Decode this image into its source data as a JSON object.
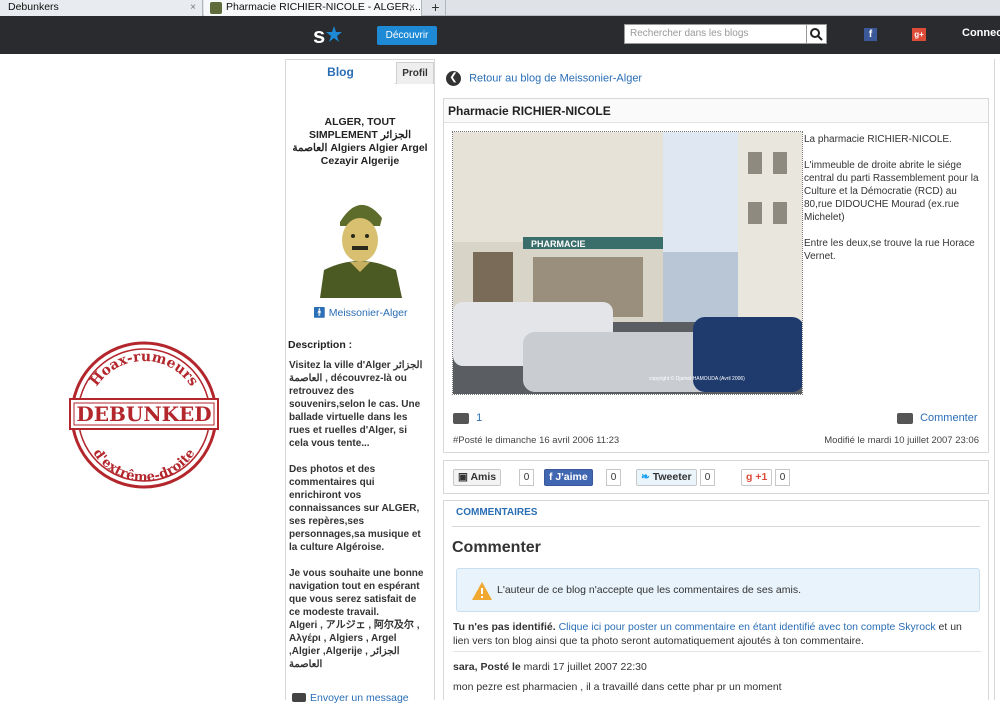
{
  "browser": {
    "tabs": [
      {
        "label": "Debunkers"
      },
      {
        "label": "Pharmacie RICHIER-NICOLE - ALGER,..."
      }
    ],
    "new_tab": "+",
    "close": "×"
  },
  "topbar": {
    "discover_label": "Découvrir",
    "search_placeholder": "Rechercher dans les blogs",
    "facebook": "f",
    "gplus": "g+",
    "connect_label": "Connect"
  },
  "stamp": {
    "top_text": "Hoax-rumeurs",
    "main_text": "DEBUNKED",
    "bottom_text": "d'extrême-droite",
    "color": "#b3262c"
  },
  "sidebar": {
    "tab_blog": "Blog",
    "tab_profil": "Profil",
    "title": "ALGER, TOUT SIMPLEMENT الجزائر العاصمة Algiers Algier Argel Cezayir Algerije",
    "username": "Meissonier-Alger",
    "description_label": "Description :",
    "description": "Visitez la ville d'Alger الجزائر العاصمة , découvrez-là ou retrouvez des souvenirs,selon le cas. Une ballade virtuelle dans les rues et ruelles d'Alger, si cela vous tente...\n\nDes photos et des commentaires qui enrichiront vos connaissances sur ALGER, ses repères,ses personnages,sa musique et la culture Algéroise.\n\nJe vous souhaite une bonne navigation tout en espérant que vous serez satisfait de ce modeste travail.\nAlgeri , アルジェ , 阿尔及尔 , Αλγέρι , Algiers , Argel ,Algier ,Algerije , الجزائر العاصمة",
    "message_link": "Envoyer un message"
  },
  "main": {
    "back_link": "Retour au blog de Meissonier-Alger",
    "post_title": "Pharmacie RICHIER-NICOLE",
    "photo_caption": "copyright © Djamel HAMOUDA (Avril 2006)",
    "photo_sign": "PHARMACIE",
    "post_paragraphs": [
      "La pharmacie RICHIER-NICOLE.",
      "L'immeuble de droite abrite le siége central du parti Rassemblement pour la Culture et la Démocratie (RCD) au 80,rue DIDOUCHE Mourad (ex.rue Michelet)",
      "Entre les deux,se trouve la rue Horace Vernet."
    ],
    "comment_count": "1",
    "comment_link": "Commenter",
    "posted": "#Posté le dimanche 16 avril 2006 11:23",
    "modified": "Modifié le mardi 10 juillet 2007 23:06"
  },
  "share": {
    "amis_label": "Amis",
    "amis_count": "0",
    "like_label": "J'aime",
    "like_count": "0",
    "tweet_label": "Tweeter",
    "tweet_count": "0",
    "gplus_label": "+1",
    "gplus_count": "0"
  },
  "comments": {
    "tab_label": "COMMENTAIRES",
    "heading": "Commenter",
    "warning": "L'auteur de ce blog n'accepte que les commentaires de ses amis.",
    "not_identified": "Tu n'es pas identifié.",
    "identify_link": "Clique ici pour poster un commentaire en étant identifié avec ton compte Skyrock",
    "identify_rest": " et un lien vers ton blog ainsi que ta photo seront automatiquement ajoutés à ton commentaire.",
    "entry_author": "sara, Posté le",
    "entry_date": " mardi 17 juillet 2007 22:30",
    "entry_text": "mon pezre est pharmacien , il a travaillé dans cette phar pr un moment"
  },
  "colors": {
    "link": "#2a6eb5",
    "topbar": "#2a2b2e",
    "discover": "#1e8ad6"
  }
}
